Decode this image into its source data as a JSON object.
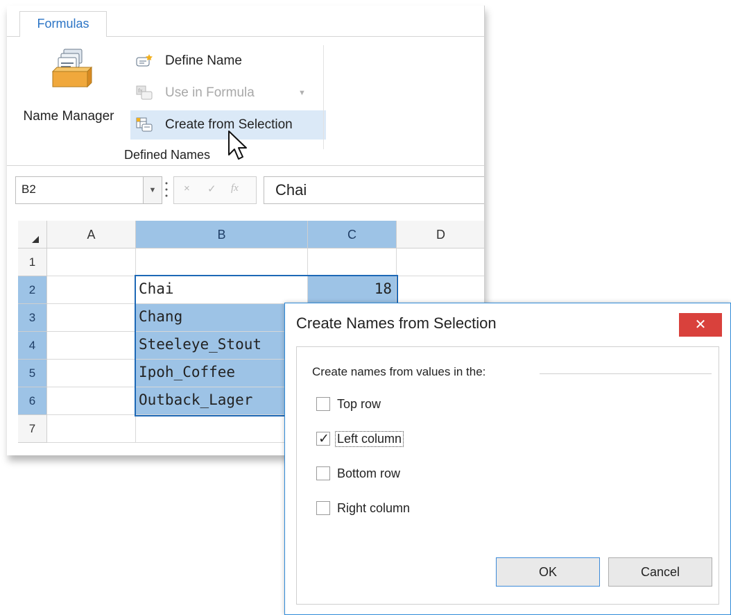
{
  "ribbon": {
    "tab_label": "Formulas",
    "name_manager_label": "Name Manager",
    "define_name_label": "Define Name",
    "use_in_formula_label": "Use in Formula",
    "create_from_selection_label": "Create from Selection",
    "group_label": "Defined Names"
  },
  "formula_bar": {
    "name_box_value": "B2",
    "cancel_glyph": "×",
    "enter_glyph": "✓",
    "fx_glyph": "fx",
    "formula_value": "Chai"
  },
  "grid": {
    "columns": [
      "A",
      "B",
      "C",
      "D"
    ],
    "selected_columns": [
      "B",
      "C"
    ],
    "rows": [
      "1",
      "2",
      "3",
      "4",
      "5",
      "6",
      "7"
    ],
    "selected_rows": [
      "2",
      "3",
      "4",
      "5",
      "6"
    ],
    "cells": {
      "B2": "Chai",
      "C2": "18",
      "B3": "Chang",
      "B4": "Steeleye_Stout",
      "B5": "Ipoh_Coffee",
      "B6": "Outback_Lager"
    }
  },
  "dialog": {
    "title": "Create Names from Selection",
    "close_glyph": "✕",
    "group_title": "Create names from values in the:",
    "options": [
      {
        "label": "Top row",
        "checked": false
      },
      {
        "label": "Left column",
        "checked": true
      },
      {
        "label": "Bottom row",
        "checked": false
      },
      {
        "label": "Right column",
        "checked": false
      }
    ],
    "ok_label": "OK",
    "cancel_label": "Cancel"
  },
  "colors": {
    "accent": "#2b74c5",
    "selection_fill": "#9dc3e6",
    "selection_border": "#1d68b6",
    "close_button": "#d9413c"
  }
}
